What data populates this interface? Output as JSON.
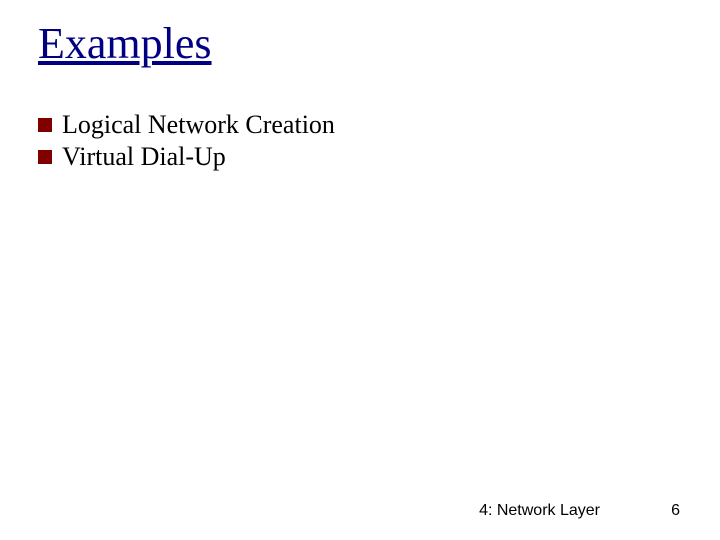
{
  "title": "Examples",
  "bullets": [
    {
      "text": "Logical Network Creation"
    },
    {
      "text": "Virtual Dial-Up"
    }
  ],
  "footer": {
    "label": "4: Network Layer",
    "page": "6"
  }
}
